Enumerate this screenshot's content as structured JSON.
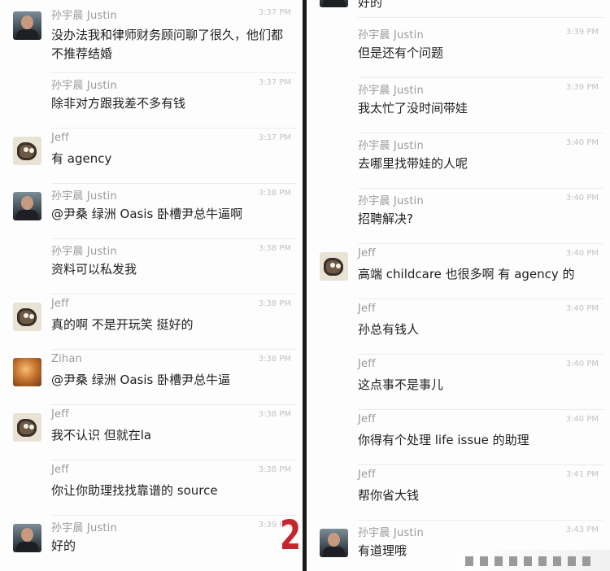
{
  "left_panel": {
    "messages": [
      {
        "sender": "孙宇晨 Justin",
        "time": "3:37 PM",
        "text": "没办法我和律师财务顾问聊了很久，他们都不推荐结婚"
      },
      {
        "sender": "孙宇晨 Justin",
        "time": "3:37 PM",
        "text": "除非对方跟我差不多有钱"
      },
      {
        "sender": "Jeff",
        "time": "3:37 PM",
        "text": "有 agency"
      },
      {
        "sender": "孙宇晨 Justin",
        "time": "3:38 PM",
        "text": "@尹桑 绿洲 Oasis 卧槽尹总牛逼啊"
      },
      {
        "sender": "孙宇晨 Justin",
        "time": "3:38 PM",
        "text": "资料可以私发我"
      },
      {
        "sender": "Jeff",
        "time": "3:38 PM",
        "text": "真的啊 不是开玩笑 挺好的"
      },
      {
        "sender": "Zihan",
        "time": "3:38 PM",
        "text": "@尹桑 绿洲 Oasis 卧槽尹总牛逼"
      },
      {
        "sender": "Jeff",
        "time": "3:38 PM",
        "text": "我不认识 但就在la"
      },
      {
        "sender": "Jeff",
        "time": "3:38 PM",
        "text": "你让你助理找找靠谱的 source"
      },
      {
        "sender": "孙宇晨 Justin",
        "time": "3:39 PM",
        "text": "好的"
      }
    ]
  },
  "right_panel": {
    "partial_top_text": "好的",
    "messages": [
      {
        "sender": "孙宇晨 Justin",
        "time": "3:39 PM",
        "text": "但是还有个问题"
      },
      {
        "sender": "孙宇晨 Justin",
        "time": "3:39 PM",
        "text": "我太忙了没时间带娃"
      },
      {
        "sender": "孙宇晨 Justin",
        "time": "3:40 PM",
        "text": "去哪里找带娃的人呢"
      },
      {
        "sender": "孙宇晨 Justin",
        "time": "3:40 PM",
        "text": "招聘解决?"
      },
      {
        "sender": "Jeff",
        "time": "3:40 PM",
        "text": "高端 childcare 也很多啊 有 agency 的"
      },
      {
        "sender": "Jeff",
        "time": "3:40 PM",
        "text": "孙总有钱人"
      },
      {
        "sender": "Jeff",
        "time": "3:40 PM",
        "text": "这点事不是事儿"
      },
      {
        "sender": "Jeff",
        "time": "3:40 PM",
        "text": "你得有个处理 life issue 的助理"
      },
      {
        "sender": "Jeff",
        "time": "3:41 PM",
        "text": "帮你省大钱"
      },
      {
        "sender": "孙宇晨 Justin",
        "time": "3:43 PM",
        "text": "有道理哦"
      }
    ]
  },
  "page_number": "2",
  "colors": {
    "page_number": "#c4262d",
    "divider": "#1a1a1a",
    "sender": "#9a9a9a",
    "time": "#c2c2c2"
  },
  "icons": {
    "justin_avatar": "person-photo-avatar",
    "jeff_avatar": "cartoon-fox-avatar",
    "zihan_avatar": "orange-photo-avatar"
  }
}
